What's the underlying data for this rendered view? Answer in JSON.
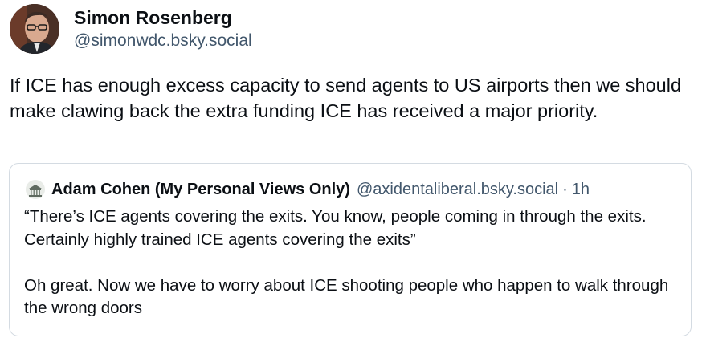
{
  "author": {
    "display_name": "Simon Rosenberg",
    "handle": "@simonwdc.bsky.social"
  },
  "post": {
    "text": "If ICE has enough excess capacity to send agents to US airports then we should make clawing back the extra funding ICE has received a major priority."
  },
  "quoted_post": {
    "author_name": "Adam Cohen (My Personal Views Only)",
    "handle": "@axidentaliberal.bsky.social",
    "separator": "·",
    "time": "1h",
    "paragraphs": [
      "“There’s ICE agents covering the exits. You know, people coming in through the exits. Certainly highly trained ICE agents covering the exits”",
      "Oh great. Now we have to worry about ICE shooting people who happen to walk through the wrong doors"
    ]
  },
  "colors": {
    "text": "#0b0f14",
    "muted": "#42576c",
    "border": "#d4dbe2"
  }
}
